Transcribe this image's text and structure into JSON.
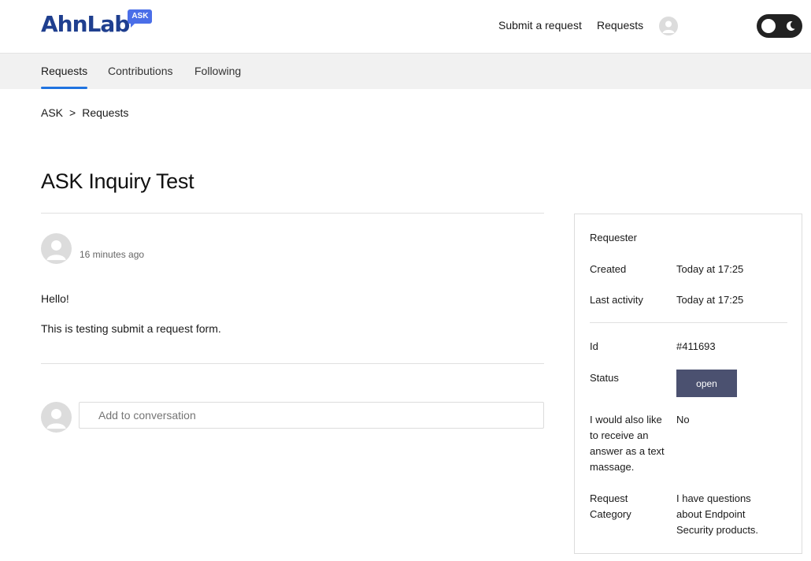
{
  "header": {
    "logo_text": "AhnLab",
    "logo_badge": "ASK",
    "nav": {
      "submit_request": "Submit a request",
      "requests": "Requests"
    }
  },
  "subnav": {
    "tabs": [
      {
        "label": "Requests",
        "active": true
      },
      {
        "label": "Contributions",
        "active": false
      },
      {
        "label": "Following",
        "active": false
      }
    ]
  },
  "breadcrumb": {
    "items": [
      "ASK",
      "Requests"
    ],
    "separator": ">"
  },
  "request": {
    "title": "ASK Inquiry Test",
    "timestamp": "16 minutes ago",
    "body_lines": [
      "Hello!",
      "This is testing submit a request form."
    ]
  },
  "comment": {
    "placeholder": "Add to conversation"
  },
  "details": {
    "requester_label": "Requester",
    "created_label": "Created",
    "created_value": "Today at 17:25",
    "last_activity_label": "Last activity",
    "last_activity_value": "Today at 17:25",
    "id_label": "Id",
    "id_value": "#411693",
    "status_label": "Status",
    "status_value": "open",
    "sms_label_lines": [
      "I would also like",
      "to receive an",
      "answer as a text",
      "massage."
    ],
    "sms_value": "No",
    "category_label_lines": [
      "Request",
      "Category"
    ],
    "category_value_lines": [
      "I have questions",
      "about Endpoint",
      "Security products."
    ]
  },
  "colors": {
    "brand": "#1f3f8f",
    "badge": "#4a6ee8",
    "active_tab_underline": "#1f73e0",
    "status_open": "#4b5170"
  },
  "icons": {
    "user_avatar": "user-icon",
    "theme_toggle": "moon-icon"
  }
}
